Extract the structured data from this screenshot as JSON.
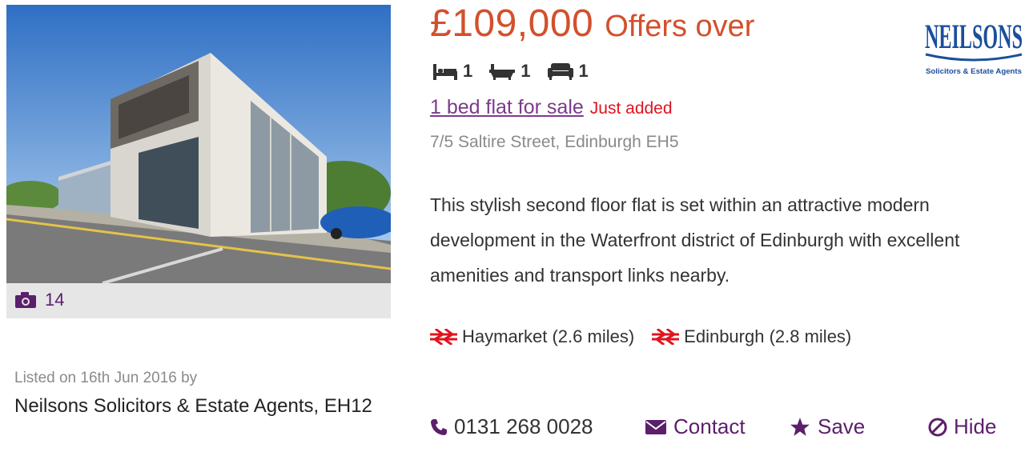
{
  "listing": {
    "price": "£109,000",
    "price_qualifier": "Offers over",
    "bedrooms": "1",
    "bathrooms": "1",
    "receptions": "1",
    "title": "1 bed flat for sale",
    "badge": "Just added",
    "address": "7/5 Saltire Street, Edinburgh EH5",
    "description": "This stylish second floor flat is set within an attractive modern development in the Waterfront district of Edinburgh with excellent amenities and transport links nearby.",
    "photo_count": "14",
    "stations": [
      {
        "label": "Haymarket (2.6 miles)",
        "icon": "national-rail-icon"
      },
      {
        "label": "Edinburgh (2.8 miles)",
        "icon": "national-rail-icon"
      }
    ]
  },
  "agent": {
    "listed_text": "Listed on 16th Jun 2016 by",
    "name": "Neilsons Solicitors & Estate Agents, EH12",
    "logo_text": "NEILSONS",
    "logo_subtext": "Solicitors & Estate Agents"
  },
  "actions": {
    "phone": "0131 268 0028",
    "contact": "Contact",
    "save": "Save",
    "hide": "Hide"
  },
  "colors": {
    "price": "#d2502c",
    "brand": "#5b1f6b",
    "link": "#7b3b8c",
    "badge": "#e0141e",
    "rail": "#e0141e",
    "logo": "#1b4f9c"
  },
  "icons": {
    "bed": "bed-icon",
    "bath": "bath-icon",
    "reception": "sofa-icon",
    "camera": "camera-icon",
    "phone": "phone-icon",
    "contact": "envelope-icon",
    "save": "star-icon",
    "hide": "no-entry-icon"
  }
}
